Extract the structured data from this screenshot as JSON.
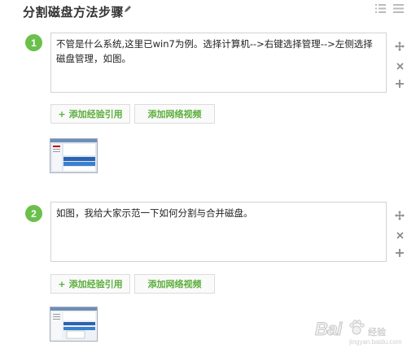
{
  "header": {
    "title": "分割磁盘方法步骤",
    "icons": [
      "edit-icon",
      "list-icon",
      "grid-icon"
    ]
  },
  "steps": [
    {
      "number": "1",
      "text": "不管是什么系统,这里已win7为例。选择计算机-->右键选择管理-->左侧选择磁盘管理，如图。",
      "add_reference_label": "添加经验引用",
      "add_video_label": "添加网络视频",
      "side_icons": [
        "move-icon",
        "close-icon",
        "add-icon"
      ]
    },
    {
      "number": "2",
      "text": "如图，我给大家示范一下如何分割与合并磁盘。",
      "add_reference_label": "添加经验引用",
      "add_video_label": "添加网络视频",
      "side_icons": [
        "move-icon",
        "close-icon",
        "add-icon"
      ]
    }
  ],
  "watermark": {
    "brand": "Bai",
    "suffix": "经验",
    "url": "jingyan.baidu.com"
  },
  "colors": {
    "accent_green": "#6bc04b",
    "button_text_green": "#5aae3a",
    "border": "#d3d3d3"
  }
}
